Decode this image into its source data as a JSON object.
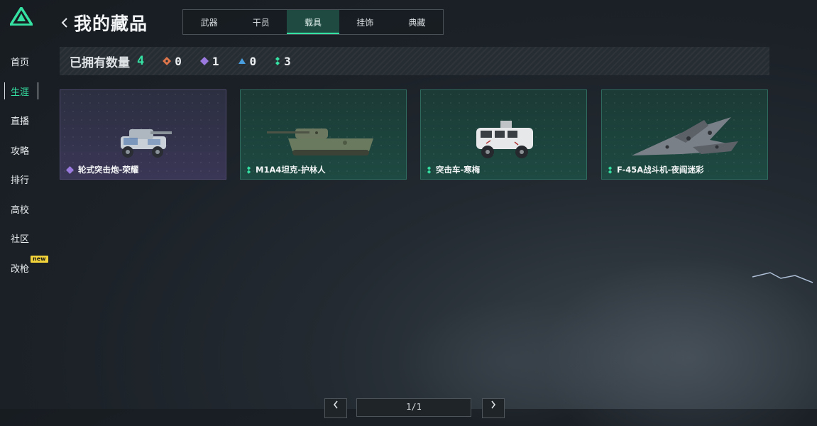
{
  "colors": {
    "accent": "#36e2a3",
    "rarity_orange": "#e0764b",
    "rarity_purple": "#9b7ae0",
    "rarity_blue": "#4a9fe0",
    "rarity_green": "#36e2a3"
  },
  "sidebar": {
    "logo": "app-logo-icon",
    "items": [
      {
        "label": "首页"
      },
      {
        "label": "生涯",
        "active": true
      },
      {
        "label": "直播"
      },
      {
        "label": "攻略"
      },
      {
        "label": "排行"
      },
      {
        "label": "高校"
      },
      {
        "label": "社区"
      },
      {
        "label": "改枪",
        "badge": "new"
      }
    ]
  },
  "header": {
    "title": "我的藏品",
    "tabs": [
      {
        "label": "武器"
      },
      {
        "label": "干员"
      },
      {
        "label": "载具",
        "active": true
      },
      {
        "label": "挂饰"
      },
      {
        "label": "典藏"
      }
    ]
  },
  "summary": {
    "owned_label": "已拥有数量",
    "owned_count": "4",
    "rarity_counts": [
      {
        "rarity": "orange",
        "icon": "diamond-orange-icon",
        "count": "0"
      },
      {
        "rarity": "purple",
        "icon": "diamond-purple-icon",
        "count": "1"
      },
      {
        "rarity": "blue",
        "icon": "triangle-blue-icon",
        "count": "0"
      },
      {
        "rarity": "green",
        "icon": "dots-green-icon",
        "count": "3"
      }
    ]
  },
  "items": [
    {
      "name": "轮式突击炮-荣耀",
      "rarity": "purple",
      "image": "wheeled-assault-gun-icon"
    },
    {
      "name": "M1A4坦克-护林人",
      "rarity": "green",
      "image": "tank-icon"
    },
    {
      "name": "突击车-寒梅",
      "rarity": "green",
      "image": "armored-vehicle-icon"
    },
    {
      "name": "F-45A战斗机-夜阎迷彩",
      "rarity": "green",
      "image": "fighter-jet-icon"
    }
  ],
  "pagination": {
    "text": "1/1"
  }
}
